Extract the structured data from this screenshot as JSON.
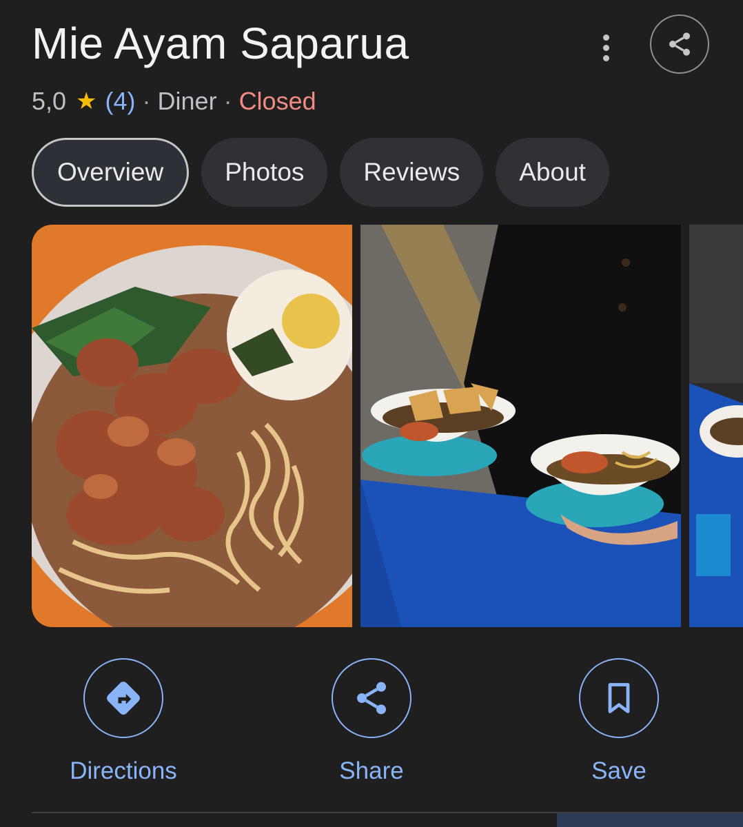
{
  "place": {
    "name": "Mie Ayam Saparua",
    "rating": "5,0",
    "review_count": "(4)",
    "category": "Diner",
    "separator": "·",
    "status": "Closed",
    "status_color": "#f28b82",
    "star_color": "#fbbc04"
  },
  "header": {
    "more_icon": "more-vert-icon",
    "share_icon": "share-icon"
  },
  "tabs": [
    {
      "label": "Overview",
      "active": true
    },
    {
      "label": "Photos",
      "active": false
    },
    {
      "label": "Reviews",
      "active": false
    },
    {
      "label": "About",
      "active": false
    }
  ],
  "photos": [
    {
      "subject": "noodle-bowl-closeup"
    },
    {
      "subject": "person-holding-two-bowls"
    },
    {
      "subject": "partial-bowl"
    }
  ],
  "actions": [
    {
      "label": "Directions",
      "icon": "directions-icon"
    },
    {
      "label": "Share",
      "icon": "share-icon"
    },
    {
      "label": "Save",
      "icon": "bookmark-icon"
    }
  ],
  "colors": {
    "background": "#1f1f1f",
    "accent": "#8ab4f8",
    "tab_background": "#303134"
  }
}
